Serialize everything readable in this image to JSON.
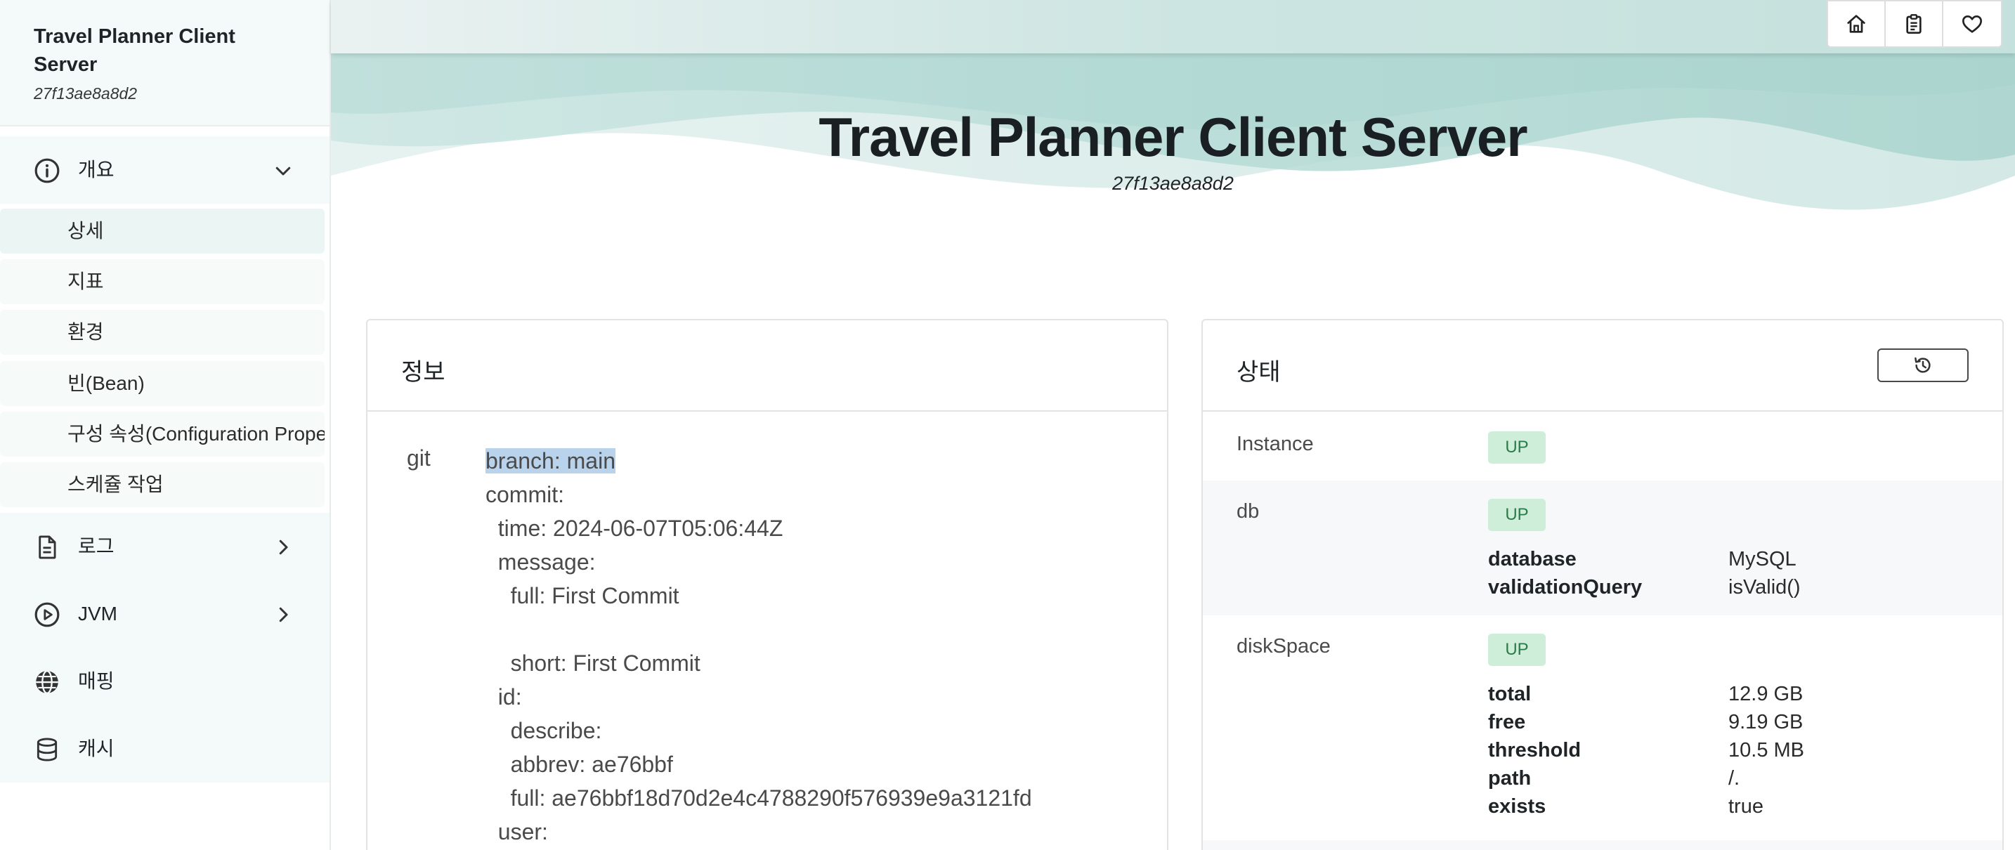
{
  "sidebar": {
    "app_title": "Travel Planner Client Server",
    "instance_id": "27f13ae8a8d2",
    "groups": {
      "overview": {
        "label": "개요",
        "icon": "info-circle-icon"
      },
      "logs": {
        "label": "로그",
        "icon": "file-icon"
      },
      "jvm": {
        "label": "JVM",
        "icon": "play-circle-icon"
      },
      "mappings": {
        "label": "매핑",
        "icon": "globe-icon"
      },
      "caches": {
        "label": "캐시",
        "icon": "database-icon"
      }
    },
    "sub_items": [
      {
        "label": "상세"
      },
      {
        "label": "지표"
      },
      {
        "label": "환경"
      },
      {
        "label": "빈(Bean)"
      },
      {
        "label": "구성 속성(Configuration Prope"
      },
      {
        "label": "스케쥴 작업"
      }
    ]
  },
  "topbar": {
    "buttons": [
      "home-icon",
      "clipboard-icon",
      "heart-icon"
    ]
  },
  "hero": {
    "title": "Travel Planner Client Server",
    "subtitle": "27f13ae8a8d2"
  },
  "info": {
    "title": "정보",
    "git_label": "git",
    "lines": [
      "branch: main",
      "commit:",
      "  time: 2024-06-07T05:06:44Z",
      "  message:",
      "    full: First Commit",
      "",
      "    short: First Commit",
      "  id:",
      "    describe:",
      "    abbrev: ae76bbf",
      "    full: ae76bbf18d70d2e4c4788290f576939e9a3121fd",
      "  user:"
    ]
  },
  "health": {
    "title": "상태",
    "refresh_icon": "history-icon",
    "rows": [
      {
        "name": "Instance",
        "status": "UP"
      },
      {
        "name": "db",
        "status": "UP",
        "details": [
          {
            "k": "database",
            "v": "MySQL"
          },
          {
            "k": "validationQuery",
            "v": "isValid()"
          }
        ]
      },
      {
        "name": "diskSpace",
        "status": "UP",
        "details": [
          {
            "k": "total",
            "v": "12.9 GB"
          },
          {
            "k": "free",
            "v": "9.19 GB"
          },
          {
            "k": "threshold",
            "v": "10.5 MB"
          },
          {
            "k": "path",
            "v": "/."
          },
          {
            "k": "exists",
            "v": "true"
          }
        ]
      }
    ]
  },
  "colors": {
    "accent": "#b9d3ec",
    "status_up_bg": "#cfeed9",
    "status_up_text": "#2b7a47",
    "sidebar_bg": "#f4faf9"
  }
}
